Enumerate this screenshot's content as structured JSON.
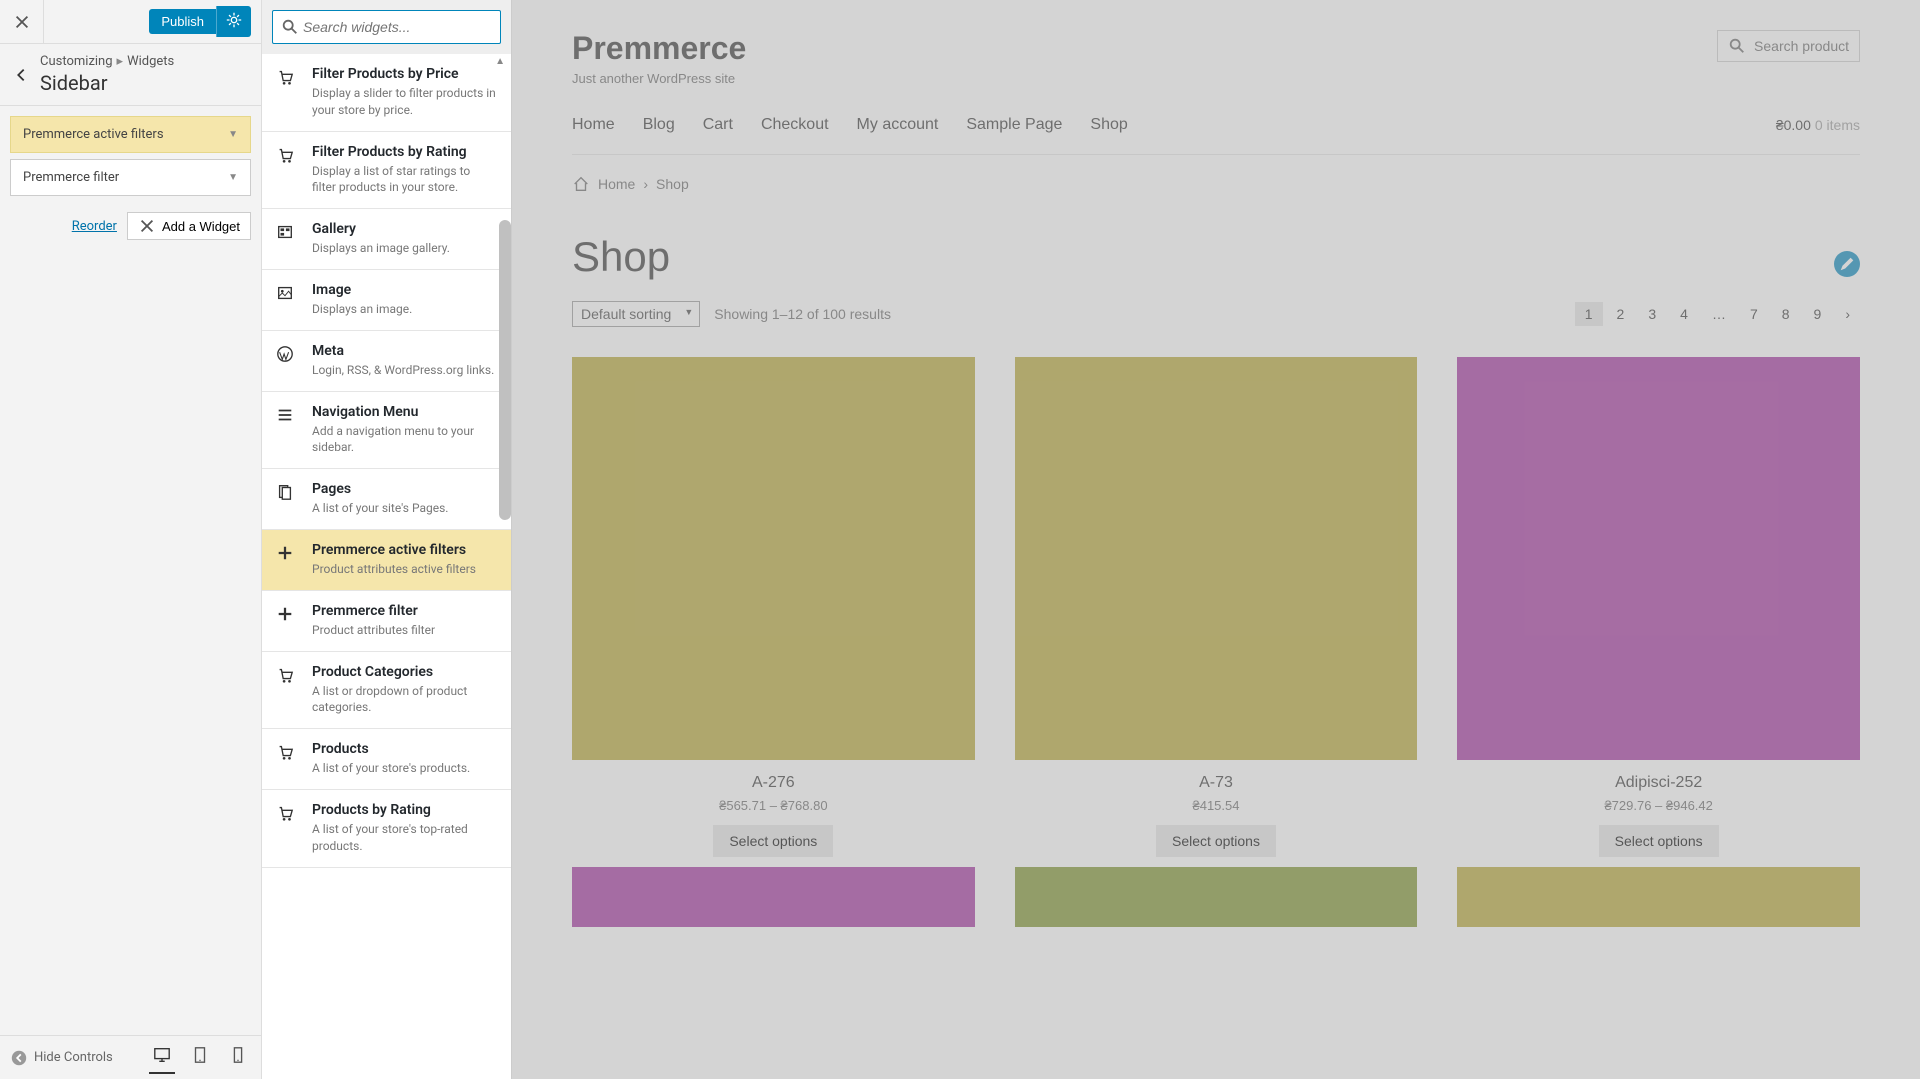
{
  "customizer": {
    "publish_label": "Publish",
    "breadcrumb_customizing": "Customizing",
    "breadcrumb_widgets": "Widgets",
    "section_title": "Sidebar",
    "sidebar_widgets": [
      {
        "label": "Premmerce active filters",
        "highlight": true
      },
      {
        "label": "Premmerce filter",
        "highlight": false
      }
    ],
    "reorder_label": "Reorder",
    "add_widget_label": "Add a Widget",
    "hide_controls_label": "Hide Controls"
  },
  "widget_panel": {
    "search_placeholder": "Search widgets...",
    "widgets": [
      {
        "icon": "cart",
        "title": "Filter Products by Price",
        "desc": "Display a slider to filter products in your store by price."
      },
      {
        "icon": "cart",
        "title": "Filter Products by Rating",
        "desc": "Display a list of star ratings to filter products in your store."
      },
      {
        "icon": "gallery",
        "title": "Gallery",
        "desc": "Displays an image gallery."
      },
      {
        "icon": "image",
        "title": "Image",
        "desc": "Displays an image."
      },
      {
        "icon": "wp",
        "title": "Meta",
        "desc": "Login, RSS, & WordPress.org links."
      },
      {
        "icon": "menu",
        "title": "Navigation Menu",
        "desc": "Add a navigation menu to your sidebar."
      },
      {
        "icon": "pages",
        "title": "Pages",
        "desc": "A list of your site's Pages."
      },
      {
        "icon": "plus",
        "title": "Premmerce active filters",
        "desc": "Product attributes active filters",
        "highlight": true
      },
      {
        "icon": "plus",
        "title": "Premmerce filter",
        "desc": "Product attributes filter"
      },
      {
        "icon": "cart",
        "title": "Product Categories",
        "desc": "A list or dropdown of product categories."
      },
      {
        "icon": "cart",
        "title": "Products",
        "desc": "A list of your store's products."
      },
      {
        "icon": "cart",
        "title": "Products by Rating",
        "desc": "A list of your store's top-rated products."
      }
    ]
  },
  "site": {
    "title": "Premmerce",
    "tagline": "Just another WordPress site",
    "search_placeholder": "Search product",
    "nav": [
      "Home",
      "Blog",
      "Cart",
      "Checkout",
      "My account",
      "Sample Page",
      "Shop"
    ],
    "cart_price": "₴0.00",
    "cart_items": "0 items",
    "breadcrumb_home": "Home",
    "breadcrumb_shop": "Shop",
    "page_title": "Shop",
    "sort_default": "Default sorting",
    "results_text": "Showing 1–12 of 100 results",
    "pagination": [
      "1",
      "2",
      "3",
      "4",
      "…",
      "7",
      "8",
      "9"
    ],
    "select_label": "Select options",
    "products": [
      {
        "name": "A-276",
        "price": "₴565.71 – ₴768.80",
        "color": "#b5a431"
      },
      {
        "name": "A-73",
        "price": "₴415.54",
        "color": "#b5a431"
      },
      {
        "name": "Adipisci-252",
        "price": "₴729.76 – ₴946.42",
        "color": "#a12f9c"
      }
    ],
    "products_row2_colors": [
      "#a12f9c",
      "#7a9128",
      "#b5a431"
    ]
  }
}
